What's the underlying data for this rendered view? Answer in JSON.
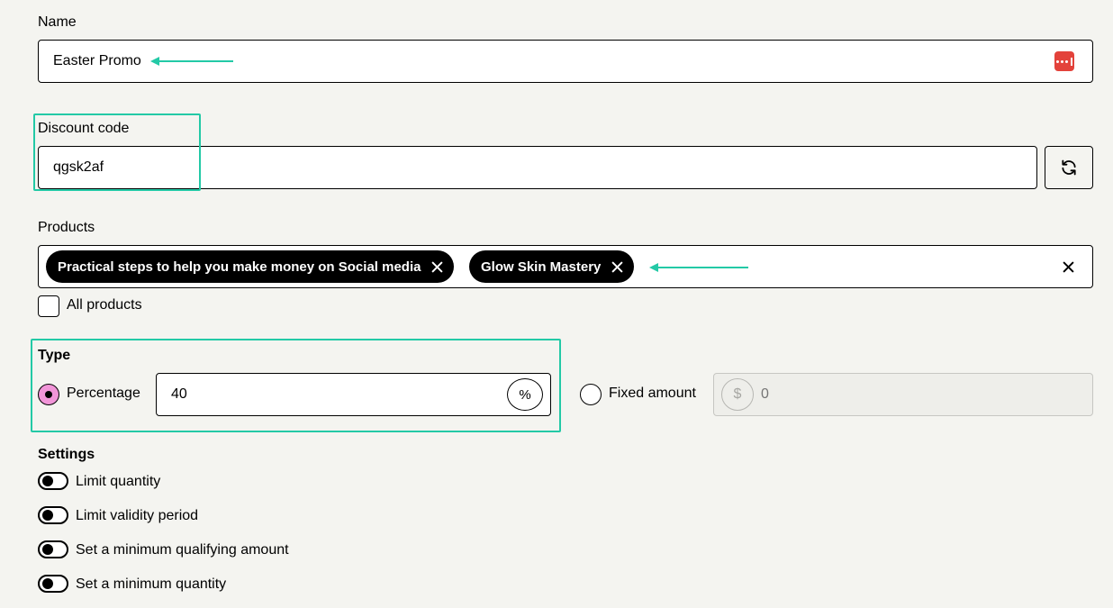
{
  "name_section": {
    "label": "Name",
    "value": "Easter Promo",
    "password_manager_icon": "password-manager-icon"
  },
  "discount_code": {
    "label": "Discount code",
    "value": "qgsk2af",
    "regenerate_icon": "refresh-icon"
  },
  "products": {
    "label": "Products",
    "selected": [
      "Practical steps to help you make money on Social media",
      "Glow Skin Mastery"
    ],
    "clear_icon": "close-icon",
    "all_products_label": "All products"
  },
  "type": {
    "label": "Type",
    "percentage_label": "Percentage",
    "percentage_value": "40",
    "percent_symbol": "%",
    "fixed_amount_label": "Fixed amount",
    "fixed_amount_placeholder": "0",
    "currency_symbol": "$",
    "selected": "Percentage"
  },
  "settings": {
    "label": "Settings",
    "toggles": [
      "Limit quantity",
      "Limit validity period",
      "Set a minimum qualifying amount",
      "Set a minimum quantity"
    ]
  },
  "colors": {
    "background": "#f4f4f0",
    "annotation": "#23c9a6",
    "radio_selected": "#f195d8",
    "password_icon": "#e3423b"
  }
}
